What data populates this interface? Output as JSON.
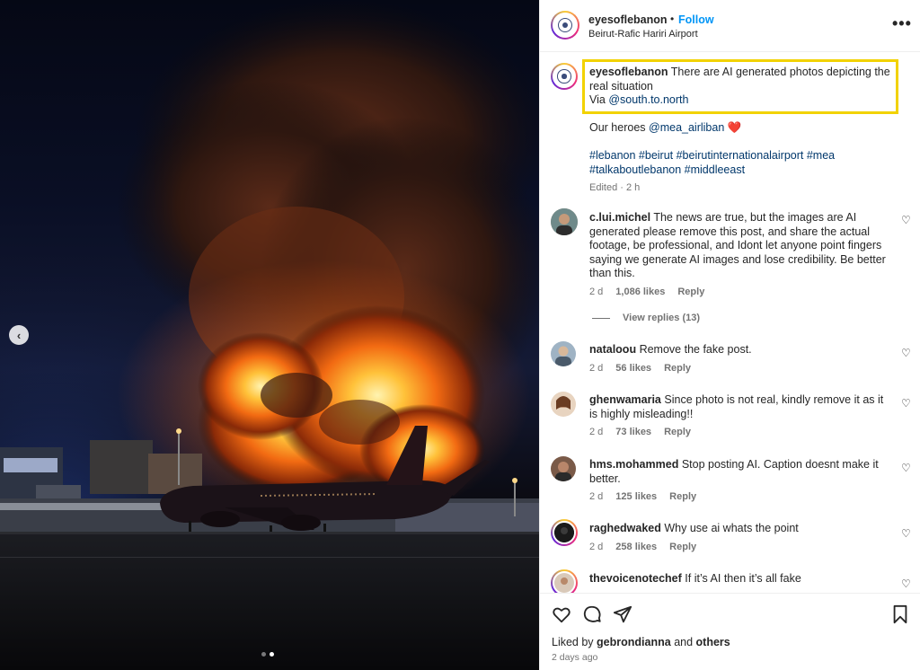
{
  "post": {
    "username": "eyesoflebanon",
    "separator": "•",
    "follow_label": "Follow",
    "location": "Beirut-Rafic Hariri Airport",
    "more_label": "•••",
    "image_nav_prev": "‹",
    "image_count_dots": 2,
    "image_active_index": 1
  },
  "caption": {
    "username": "eyesoflebanon",
    "text": "There are AI generated photos depicting the real situation",
    "via_label": "Via",
    "via_handle": "@south.to.north",
    "heroes_text": "Our heroes",
    "heroes_handle": "@mea_airliban",
    "heart_emoji": "❤️",
    "hashtags_line1": "#lebanon #beirut #beirutinternationalairport #mea",
    "hashtags_line2": "#talkaboutlebanon #middleeast",
    "edited": "Edited · 2 h"
  },
  "comments": [
    {
      "username": "c.lui.michel",
      "text": "The news are true, but the images are AI generated please remove this post, and share the actual footage, be professional, and Idont let anyone point fingers saying we generate AI images and lose credibility. Be better than this.",
      "time": "2 d",
      "likes": "1,086 likes",
      "reply_label": "Reply",
      "view_replies": "View replies (13)"
    },
    {
      "username": "nataloou",
      "text": "Remove the fake post.",
      "time": "2 d",
      "likes": "56 likes",
      "reply_label": "Reply"
    },
    {
      "username": "ghenwamaria",
      "text": "Since photo is not real, kindly remove it as it is highly misleading!!",
      "time": "2 d",
      "likes": "73 likes",
      "reply_label": "Reply"
    },
    {
      "username": "hms.mohammed",
      "text": "Stop posting AI. Caption doesnt make it better.",
      "time": "2 d",
      "likes": "125 likes",
      "reply_label": "Reply"
    },
    {
      "username": "raghedwaked",
      "text": "Why use ai whats the point",
      "time": "2 d",
      "likes": "258 likes",
      "reply_label": "Reply"
    },
    {
      "username": "thevoicenotechef",
      "text": "If it’s AI then it’s all fake"
    }
  ],
  "footer": {
    "liked_by_prefix": "Liked by",
    "liked_by_user": "gebrondianna",
    "liked_by_and": "and",
    "liked_by_others": "others",
    "posted_ago": "2 days ago"
  },
  "icons": {
    "like": "heart-outline-icon",
    "comment": "comment-bubble-icon",
    "share": "paper-plane-icon",
    "save": "bookmark-icon"
  },
  "colors": {
    "follow_blue": "#0095f6",
    "link_blue": "#00376b",
    "highlight_yellow": "#f2d200",
    "muted_gray": "#737373"
  }
}
